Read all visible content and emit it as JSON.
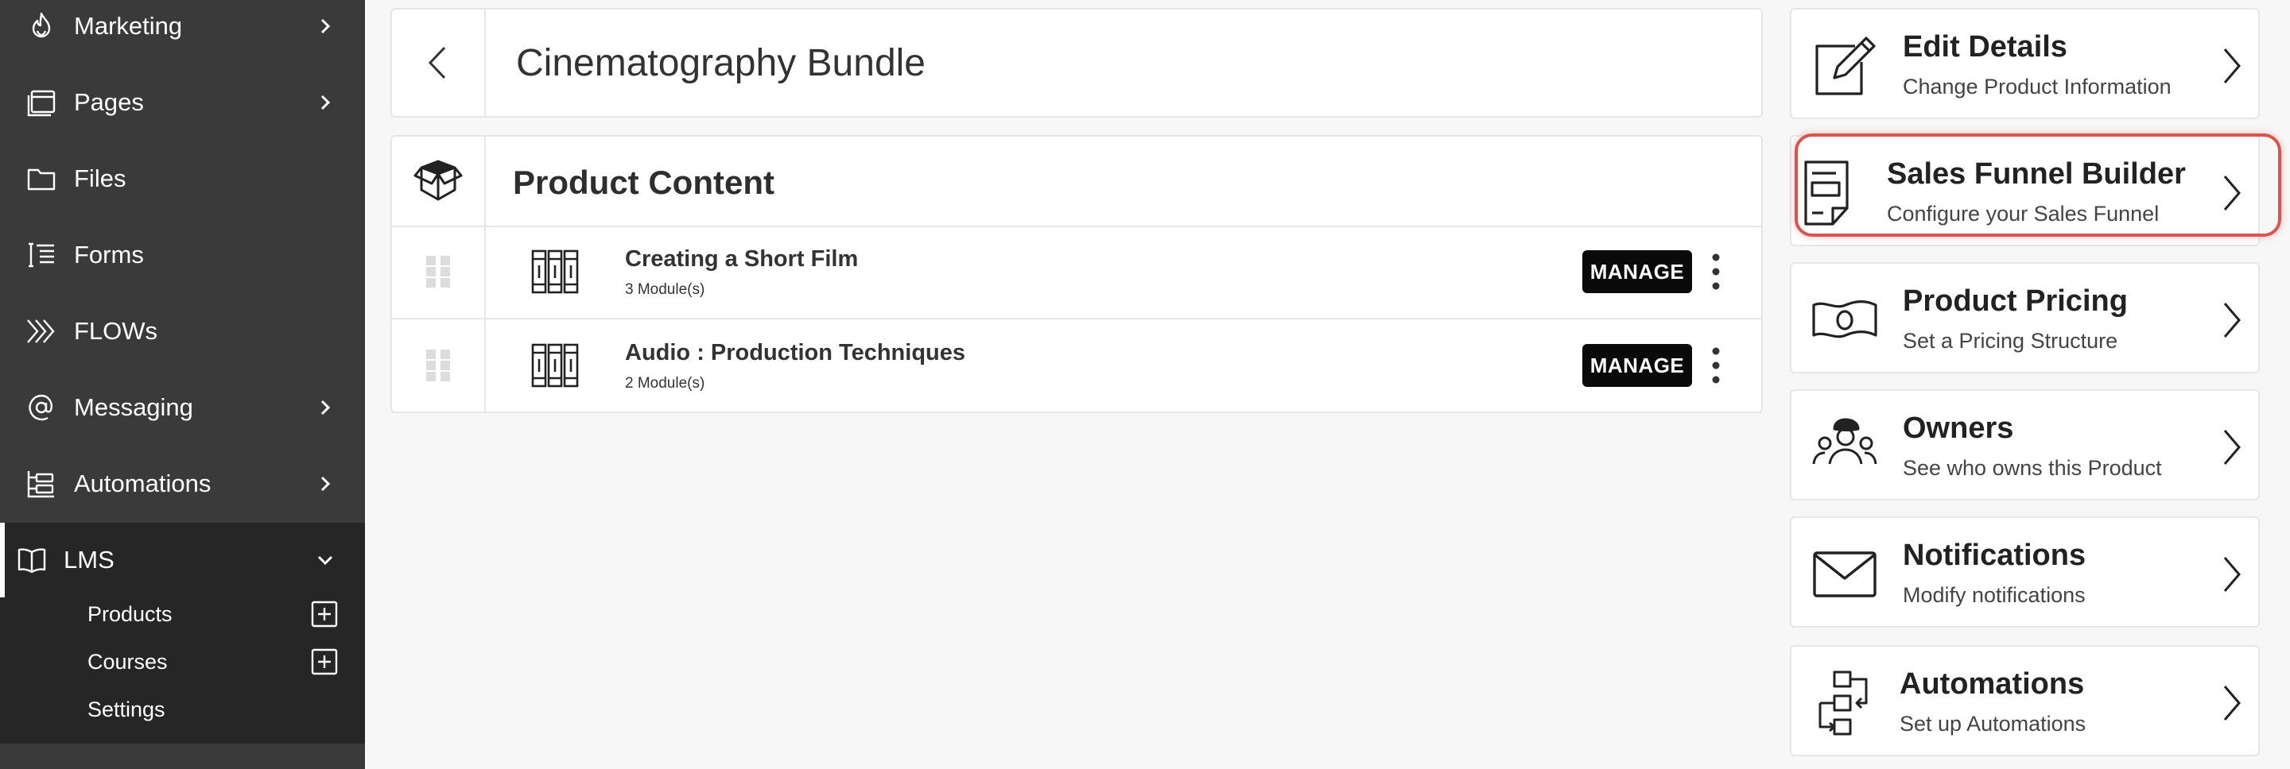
{
  "sidebar": {
    "items": [
      {
        "label": "Marketing",
        "icon": "flame-icon",
        "has_chevron": true
      },
      {
        "label": "Pages",
        "icon": "pages-icon",
        "has_chevron": true
      },
      {
        "label": "Files",
        "icon": "folder-icon",
        "has_chevron": false
      },
      {
        "label": "Forms",
        "icon": "form-list-icon",
        "has_chevron": false
      },
      {
        "label": "FLOWs",
        "icon": "flow-chevrons-icon",
        "has_chevron": false
      },
      {
        "label": "Messaging",
        "icon": "at-icon",
        "has_chevron": true
      },
      {
        "label": "Automations",
        "icon": "automation-icon",
        "has_chevron": true
      },
      {
        "label": "LMS",
        "icon": "book-open-icon",
        "expanded": true
      }
    ],
    "lms_sub": [
      {
        "label": "Products",
        "has_plus": true
      },
      {
        "label": "Courses",
        "has_plus": true
      },
      {
        "label": "Settings",
        "has_plus": false
      }
    ]
  },
  "header": {
    "title": "Cinematography Bundle"
  },
  "content": {
    "title": "Product Content",
    "courses": [
      {
        "title": "Creating a Short Film",
        "modules": "3 Module(s)",
        "action": "MANAGE"
      },
      {
        "title": "Audio : Production Techniques",
        "modules": "2 Module(s)",
        "action": "MANAGE"
      }
    ]
  },
  "cards": [
    {
      "title": "Edit Details",
      "subtitle": "Change Product Information",
      "icon": "edit-pencil-icon"
    },
    {
      "title": "Sales Funnel Builder",
      "subtitle": "Configure your Sales Funnel",
      "icon": "funnel-document-icon",
      "highlighted": true
    },
    {
      "title": "Product Pricing",
      "subtitle": "Set a Pricing Structure",
      "icon": "banknote-icon"
    },
    {
      "title": "Owners",
      "subtitle": "See who owns this Product",
      "icon": "owners-people-icon"
    },
    {
      "title": "Notifications",
      "subtitle": "Modify notifications",
      "icon": "envelope-icon"
    },
    {
      "title": "Automations",
      "subtitle": "Set up Automations",
      "icon": "automation-flow-icon"
    }
  ],
  "colors": {
    "sidebar_bg": "#3a3a3a",
    "sidebar_active_bg": "#262626",
    "highlight": "#d9534f",
    "button_bg": "#0a0a0a"
  }
}
